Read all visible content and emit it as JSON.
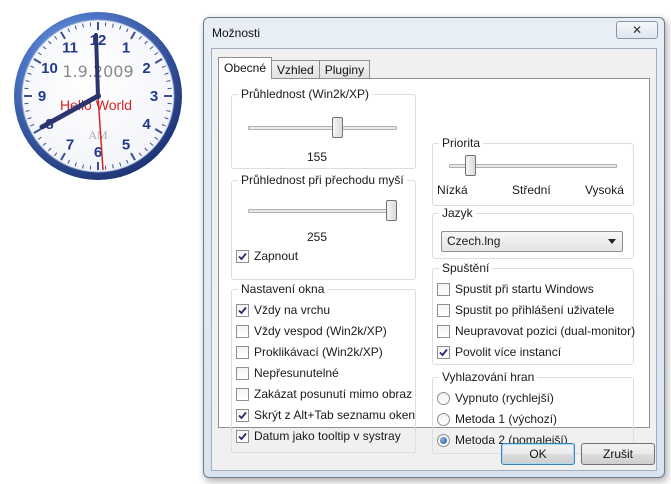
{
  "clock": {
    "numbers": [
      "12",
      "1",
      "2",
      "3",
      "4",
      "5",
      "6",
      "7",
      "8",
      "9",
      "10",
      "11"
    ],
    "date": "1.9.2009",
    "text": "Hello World",
    "ampm": "AM"
  },
  "dialog": {
    "title": "Možnosti",
    "close_glyph": "✕",
    "tabs": [
      "Obecné",
      "Vzhled",
      "Pluginy"
    ],
    "transparency": {
      "label": "Průhlednost (Win2k/XP)",
      "value": "155",
      "level": 155,
      "max": 255
    },
    "hover_transparency": {
      "label": "Průhlednost při přechodu myší",
      "value": "255",
      "level": 255,
      "max": 255,
      "enable_label": "Zapnout",
      "enabled": true
    },
    "window_settings": {
      "label": "Nastavení okna",
      "items": [
        {
          "label": "Vždy na vrchu",
          "checked": true
        },
        {
          "label": "Vždy vespod (Win2k/XP)",
          "checked": false
        },
        {
          "label": "Proklikávací (Win2k/XP)",
          "checked": false
        },
        {
          "label": "Nepřesunutelné",
          "checked": false
        },
        {
          "label": "Zakázat posunutí mimo obraz",
          "checked": false
        },
        {
          "label": "Skrýt z Alt+Tab seznamu oken",
          "checked": true
        },
        {
          "label": "Datum jako tooltip v systray",
          "checked": true
        }
      ]
    },
    "priority": {
      "label": "Priorita",
      "ticks": [
        "Nízká",
        "Střední",
        "Vysoká"
      ],
      "level": 0.1
    },
    "language": {
      "label": "Jazyk",
      "value": "Czech.lng"
    },
    "startup": {
      "label": "Spuštění",
      "items": [
        {
          "label": "Spustit při startu Windows",
          "checked": false
        },
        {
          "label": "Spustit po přihlášení uživatele",
          "checked": false
        },
        {
          "label": "Neupravovat pozici (dual-monitor)",
          "checked": false
        },
        {
          "label": "Povolit více instancí",
          "checked": true
        }
      ]
    },
    "smoothing": {
      "label": "Vyhlazování hran",
      "options": [
        {
          "label": "Vypnuto (rychlejší)",
          "selected": false
        },
        {
          "label": "Metoda 1 (výchozí)",
          "selected": false
        },
        {
          "label": "Metoda 2 (pomalejší)",
          "selected": true
        }
      ]
    },
    "ok_label": "OK",
    "cancel_label": "Zrušit"
  }
}
